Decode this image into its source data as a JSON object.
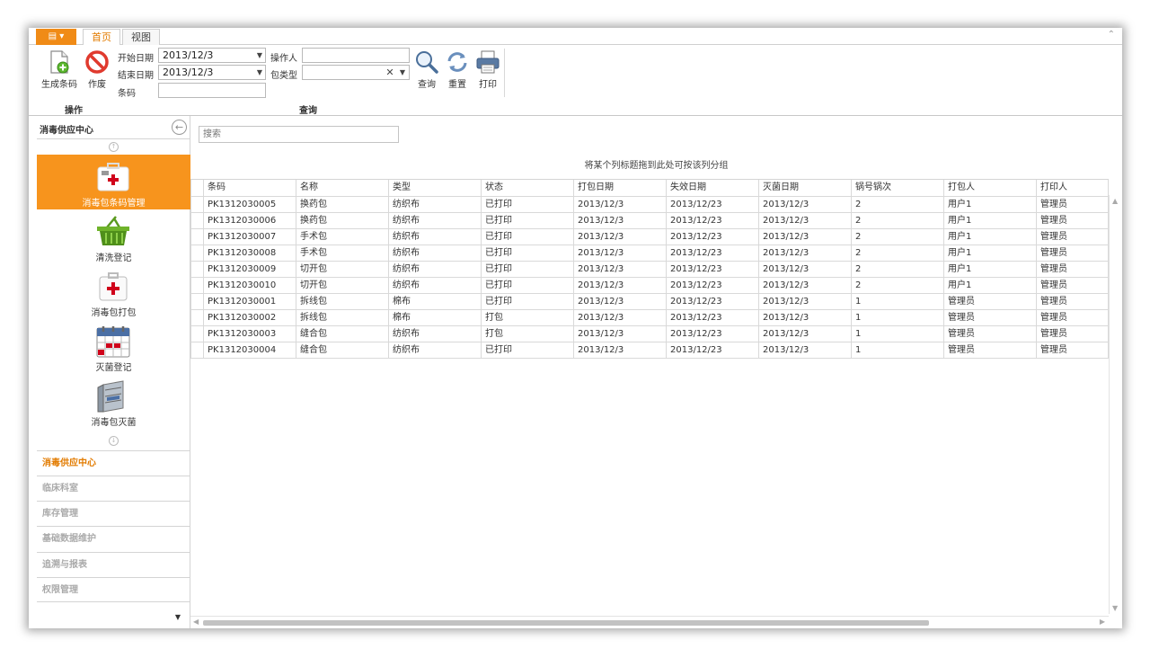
{
  "ribbon": {
    "tabs": [
      "首页",
      "视图"
    ],
    "groups": {
      "operations": "操作",
      "query": "查询"
    },
    "buttons": {
      "generate": "生成条码",
      "void": "作废",
      "search": "查询",
      "reset": "重置",
      "print": "打印"
    },
    "fields": {
      "start_date_label": "开始日期",
      "start_date_value": "2013/12/3",
      "end_date_label": "结束日期",
      "end_date_value": "2013/12/3",
      "barcode_label": "条码",
      "barcode_value": "",
      "operator_label": "操作人",
      "operator_value": "",
      "pack_type_label": "包类型",
      "pack_type_value": ""
    }
  },
  "nav": {
    "title": "消毒供应中心",
    "items": [
      {
        "label": "消毒包条码管理",
        "active": true
      },
      {
        "label": "清洗登记"
      },
      {
        "label": "消毒包打包"
      },
      {
        "label": "灭菌登记"
      },
      {
        "label": "消毒包灭菌"
      }
    ],
    "groups": [
      "消毒供应中心",
      "临床科室",
      "库存管理",
      "基础数据维护",
      "追溯与报表",
      "权限管理"
    ]
  },
  "main": {
    "search_placeholder": "搜索",
    "group_hint": "将某个列标题拖到此处可按该列分组",
    "columns": [
      "条码",
      "名称",
      "类型",
      "状态",
      "打包日期",
      "失效日期",
      "灭菌日期",
      "锅号锅次",
      "打包人",
      "打印人"
    ],
    "rows": [
      [
        "PK1312030005",
        "换药包",
        "纺织布",
        "已打印",
        "2013/12/3",
        "2013/12/23",
        "2013/12/3",
        "2",
        "用户1",
        "管理员"
      ],
      [
        "PK1312030006",
        "换药包",
        "纺织布",
        "已打印",
        "2013/12/3",
        "2013/12/23",
        "2013/12/3",
        "2",
        "用户1",
        "管理员"
      ],
      [
        "PK1312030007",
        "手术包",
        "纺织布",
        "已打印",
        "2013/12/3",
        "2013/12/23",
        "2013/12/3",
        "2",
        "用户1",
        "管理员"
      ],
      [
        "PK1312030008",
        "手术包",
        "纺织布",
        "已打印",
        "2013/12/3",
        "2013/12/23",
        "2013/12/3",
        "2",
        "用户1",
        "管理员"
      ],
      [
        "PK1312030009",
        "切开包",
        "纺织布",
        "已打印",
        "2013/12/3",
        "2013/12/23",
        "2013/12/3",
        "2",
        "用户1",
        "管理员"
      ],
      [
        "PK1312030010",
        "切开包",
        "纺织布",
        "已打印",
        "2013/12/3",
        "2013/12/23",
        "2013/12/3",
        "2",
        "用户1",
        "管理员"
      ],
      [
        "PK1312030001",
        "拆线包",
        "棉布",
        "已打印",
        "2013/12/3",
        "2013/12/23",
        "2013/12/3",
        "1",
        "管理员",
        "管理员"
      ],
      [
        "PK1312030002",
        "拆线包",
        "棉布",
        "打包",
        "2013/12/3",
        "2013/12/23",
        "2013/12/3",
        "1",
        "管理员",
        "管理员"
      ],
      [
        "PK1312030003",
        "缝合包",
        "纺织布",
        "打包",
        "2013/12/3",
        "2013/12/23",
        "2013/12/3",
        "1",
        "管理员",
        "管理员"
      ],
      [
        "PK1312030004",
        "缝合包",
        "纺织布",
        "已打印",
        "2013/12/3",
        "2013/12/23",
        "2013/12/3",
        "1",
        "管理员",
        "管理员"
      ]
    ]
  },
  "colors": {
    "accent": "#f7941d",
    "accent_text": "#e27b00"
  }
}
